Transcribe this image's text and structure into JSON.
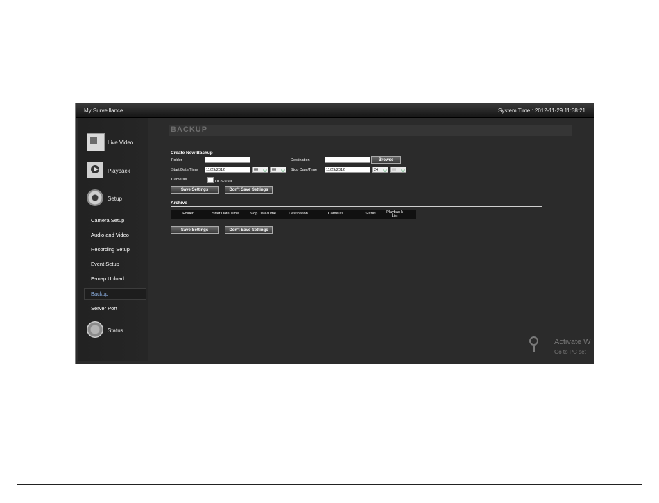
{
  "window": {
    "app_title": "My Surveillance",
    "system_time": "System Time : 2012-11-29 11:38:21"
  },
  "sidebar": {
    "main": [
      {
        "label": "Live Video",
        "icon": "live-video-icon"
      },
      {
        "label": "Playback",
        "icon": "playback-icon"
      },
      {
        "label": "Setup",
        "icon": "gear-icon"
      },
      {
        "label": "Status",
        "icon": "status-icon"
      }
    ],
    "setup_items": [
      {
        "label": "Camera Setup"
      },
      {
        "label": "Audio and Video"
      },
      {
        "label": "Recording Setup"
      },
      {
        "label": "Event Setup"
      },
      {
        "label": "E-map Upload"
      },
      {
        "label": "Backup",
        "active": true
      },
      {
        "label": "Server Port"
      }
    ]
  },
  "page": {
    "title": "BACKUP",
    "create_section": "Create New Backup",
    "folder_label": "Folder",
    "folder_value": "",
    "destination_label": "Destination",
    "destination_value": "",
    "browse_label": "Browse",
    "start_label": "Start Date/Time",
    "start_date": "11/29/2012",
    "start_hour": "00",
    "start_min": "00",
    "stop_label": "Stop Date/Time",
    "stop_date": "11/29/2012",
    "stop_hour": "24",
    "stop_min": "00",
    "cameras_label": "Cameras",
    "camera_name": "DCS-930L",
    "save_label": "Save Settings",
    "dont_save_label": "Don't Save Settings",
    "archive_section": "Archive",
    "archive_columns": [
      "Folder",
      "Start Date/Time",
      "Stop Date/Time",
      "Destination",
      "Cameras",
      "Status",
      "Playbac k List"
    ]
  },
  "watermark": {
    "line1": "Activate W",
    "line2": "Go to PC set"
  },
  "colors": {
    "active_nav": "#8fb3e6",
    "background": "#2b2b2b"
  }
}
